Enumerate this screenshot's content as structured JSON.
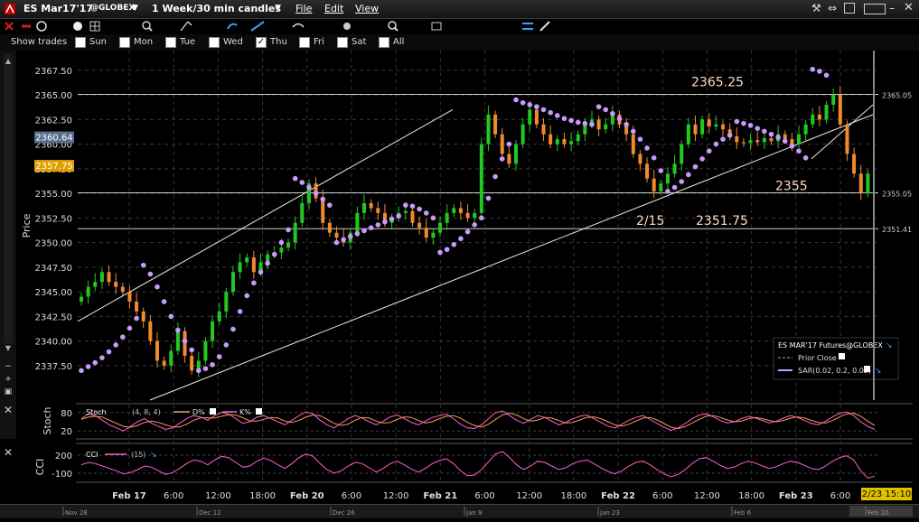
{
  "window": {
    "symbol": "ES Mar17'17",
    "exchange": "@GLOBEX",
    "timeframe": "1 Week/30 min candles",
    "menus": [
      "File",
      "Edit",
      "View"
    ]
  },
  "options": {
    "show_trades_label": "Show trades",
    "days": [
      {
        "label": "Sun",
        "checked": false
      },
      {
        "label": "Mon",
        "checked": false
      },
      {
        "label": "Tue",
        "checked": false
      },
      {
        "label": "Wed",
        "checked": false
      },
      {
        "label": "Thu",
        "checked": true
      },
      {
        "label": "Fri",
        "checked": false
      },
      {
        "label": "Sat",
        "checked": false
      },
      {
        "label": "All",
        "checked": false
      }
    ]
  },
  "chart_data": {
    "type": "candlestick",
    "ylabel": "Price",
    "ylim": [
      2334.0,
      2369.5
    ],
    "yticks": [
      "2367.50",
      "2365.00",
      "2362.50",
      "2360.00",
      "2357.50",
      "2355.00",
      "2352.50",
      "2350.00",
      "2347.50",
      "2345.00",
      "2342.50",
      "2340.00",
      "2337.50"
    ],
    "x_labels": [
      "Feb 17",
      "6:00",
      "12:00",
      "18:00",
      "Feb 20",
      "6:00",
      "12:00",
      "Feb 21",
      "6:00",
      "12:00",
      "18:00",
      "Feb 22",
      "6:00",
      "12:00",
      "18:00",
      "Feb 23",
      "6:00"
    ],
    "price_badges": [
      {
        "label": "2360.64",
        "value": 2360.64,
        "color": "#5a6f8a"
      },
      {
        "label": "2357.75",
        "value": 2357.75,
        "color": "#e0a000"
      }
    ],
    "right_labels": [
      {
        "label": "2365.05",
        "value": 2365.05
      },
      {
        "label": "2355.05",
        "value": 2355.05
      },
      {
        "label": "2351.41",
        "value": 2351.41
      }
    ],
    "annotations": [
      {
        "text": "2365.25",
        "value": 2365.25
      },
      {
        "text": "2355",
        "value": 2355.05
      },
      {
        "text": "2/15",
        "value": 2351.41
      },
      {
        "text": "2351.75",
        "value": 2351.41
      }
    ],
    "horizontal_levels": [
      2365.05,
      2355.05,
      2351.41
    ],
    "channel_upper": [
      [
        0,
        2342
      ],
      [
        415,
        2363.5
      ]
    ],
    "channel_lower": [
      [
        80,
        2334
      ],
      [
        880,
        2363
      ]
    ],
    "channel_short": [
      [
        812,
        2358.5
      ],
      [
        880,
        2364
      ]
    ],
    "series": [
      {
        "name": "ES MAR'17 Futures@GLOBEX",
        "kind": "candles",
        "up_color": "#22c822",
        "down_color": "#f08a30",
        "close": [
          2344.5,
          2345.5,
          2346,
          2347,
          2346,
          2345.5,
          2345,
          2344,
          2343,
          2342,
          2340,
          2338,
          2337.5,
          2339,
          2341,
          2338.5,
          2337,
          2338,
          2340,
          2342,
          2343,
          2345,
          2347,
          2348,
          2348.5,
          2347,
          2348,
          2348.8,
          2349,
          2349.5,
          2350,
          2352,
          2354,
          2356,
          2354.5,
          2352,
          2351,
          2350.5,
          2350,
          2351,
          2353,
          2354,
          2353.5,
          2353,
          2352,
          2352.5,
          2353,
          2353.2,
          2352,
          2351.5,
          2350.5,
          2351,
          2352,
          2353,
          2353.5,
          2353,
          2352.5,
          2353,
          2360,
          2363,
          2361,
          2359,
          2358,
          2360,
          2362,
          2363.5,
          2362,
          2361,
          2360,
          2360.5,
          2360,
          2360.3,
          2361,
          2362,
          2362.5,
          2361.5,
          2362,
          2363,
          2362,
          2361,
          2359,
          2358,
          2356.5,
          2355.2,
          2356,
          2357,
          2358,
          2360,
          2362,
          2361,
          2362.5,
          2361.8,
          2362,
          2361.5,
          2360.8,
          2360.2,
          2360.1,
          2360.4,
          2360.2,
          2360.6,
          2360.3,
          2361,
          2360.5,
          2360,
          2361,
          2362,
          2363,
          2362.5,
          2364,
          2365,
          2362,
          2359,
          2357,
          2355,
          2357
        ]
      }
    ],
    "sar": [
      2337.0,
      2337.4,
      2337.8,
      2338.3,
      2338.9,
      2339.6,
      2340.4,
      2341.3,
      2342.3,
      2347.7,
      2346.8,
      2345.5,
      2344.0,
      2342.5,
      2341.1,
      2340.0,
      2339.1,
      2337.0,
      2337.2,
      2337.6,
      2338.4,
      2339.6,
      2341.2,
      2343.0,
      2344.6,
      2345.9,
      2347.0,
      2347.9,
      2348.8,
      2350.0,
      2351.3,
      2356.5,
      2356.1,
      2355.6,
      2355.0,
      2354.4,
      2353.8,
      2350.0,
      2350.3,
      2350.6,
      2350.9,
      2351.2,
      2351.5,
      2351.8,
      2352.1,
      2352.4,
      2352.7,
      2353.8,
      2353.7,
      2353.4,
      2353.0,
      2352.5,
      2349.0,
      2349.3,
      2349.8,
      2350.4,
      2351.1,
      2351.8,
      2352.5,
      2354.5,
      2356.7,
      2358.5,
      2360.0,
      2364.5,
      2364.2,
      2364.0,
      2363.8,
      2363.5,
      2363.2,
      2362.9,
      2362.6,
      2362.4,
      2362.2,
      2362.1,
      2362.0,
      2363.8,
      2363.5,
      2363.1,
      2362.6,
      2362.0,
      2361.3,
      2360.5,
      2359.6,
      2358.6,
      2357.3,
      2355.2,
      2355.6,
      2356.2,
      2356.9,
      2357.7,
      2358.5,
      2359.3,
      2360.0,
      2360.5,
      2360.9,
      2362.3,
      2362.1,
      2361.9,
      2361.6,
      2361.3,
      2361.0,
      2360.7,
      2360.3,
      2359.8,
      2359.3,
      2358.6,
      2367.6,
      2367.4,
      2367.0
    ],
    "sar_color": "#c89aff",
    "legend": {
      "title": "ES MAR'17 Futures@GLOBEX",
      "items": [
        "Prior Close",
        "SAR(0.02, 0.2, 0.02)"
      ]
    },
    "stoch": {
      "label": "Stoch",
      "params": "(4, 8, 4)",
      "lines": [
        "D%",
        "K%"
      ],
      "yticks": [
        "80",
        "20"
      ],
      "ylim": [
        0,
        100
      ],
      "k": [
        60,
        75,
        70,
        55,
        40,
        30,
        20,
        35,
        50,
        60,
        45,
        35,
        25,
        30,
        45,
        60,
        70,
        65,
        55,
        70,
        80,
        75,
        60,
        45,
        50,
        65,
        70,
        60,
        50,
        40,
        55,
        70,
        82,
        76,
        55,
        40,
        30,
        45,
        60,
        70,
        62,
        50,
        40,
        52,
        66,
        72,
        60,
        48,
        40,
        52,
        64,
        70,
        75,
        60,
        42,
        30,
        28,
        40,
        60,
        80,
        85,
        70,
        55,
        45,
        58,
        70,
        64,
        52,
        40,
        48,
        60,
        68,
        72,
        60,
        48,
        36,
        30,
        42,
        55,
        64,
        70,
        58,
        44,
        32,
        22,
        30,
        44,
        60,
        72,
        76,
        66,
        54,
        46,
        50,
        60,
        68,
        62,
        54,
        46,
        52,
        62,
        70,
        64,
        54,
        44,
        40,
        52,
        66,
        78,
        82,
        70,
        50,
        35,
        25
      ],
      "d": [
        58,
        65,
        68,
        65,
        55,
        45,
        35,
        32,
        38,
        48,
        52,
        48,
        40,
        33,
        33,
        42,
        55,
        63,
        63,
        62,
        68,
        73,
        72,
        63,
        53,
        52,
        58,
        64,
        62,
        52,
        48,
        55,
        65,
        72,
        70,
        58,
        45,
        38,
        42,
        55,
        64,
        62,
        52,
        46,
        48,
        58,
        66,
        64,
        54,
        46,
        50,
        60,
        68,
        70,
        62,
        48,
        38,
        33,
        42,
        58,
        72,
        78,
        72,
        60,
        52,
        55,
        64,
        62,
        54,
        46,
        48,
        56,
        64,
        66,
        60,
        50,
        40,
        36,
        42,
        52,
        62,
        64,
        56,
        44,
        32,
        28,
        34,
        46,
        58,
        68,
        70,
        64,
        56,
        50,
        52,
        60,
        64,
        60,
        54,
        50,
        54,
        62,
        66,
        62,
        54,
        48,
        46,
        54,
        66,
        76,
        78,
        68,
        52,
        38
      ]
    },
    "cci": {
      "label": "CCI",
      "params": "(15)",
      "yticks": [
        "200",
        "-100"
      ],
      "ylim": [
        -220,
        320
      ],
      "values": [
        40,
        80,
        60,
        20,
        -20,
        -60,
        -110,
        -90,
        -40,
        20,
        0,
        -60,
        -120,
        -90,
        -20,
        60,
        120,
        100,
        40,
        120,
        180,
        160,
        80,
        0,
        20,
        100,
        150,
        110,
        40,
        -20,
        60,
        160,
        220,
        180,
        60,
        -40,
        -100,
        -60,
        20,
        80,
        60,
        -10,
        -80,
        -20,
        60,
        100,
        40,
        -30,
        -80,
        -20,
        60,
        110,
        140,
        60,
        -60,
        -140,
        -130,
        -40,
        90,
        220,
        260,
        160,
        40,
        -40,
        20,
        100,
        80,
        20,
        -40,
        -10,
        60,
        100,
        120,
        60,
        -10,
        -70,
        -110,
        -60,
        20,
        80,
        100,
        40,
        -40,
        -110,
        -160,
        -120,
        -40,
        60,
        140,
        160,
        100,
        30,
        -20,
        0,
        60,
        100,
        70,
        20,
        -20,
        10,
        60,
        100,
        80,
        30,
        -20,
        -40,
        20,
        100,
        160,
        190,
        120,
        -60,
        -180,
        -150
      ]
    },
    "x_axis_badge": "2/23 15:10",
    "bottom_dates": [
      "Nov 28",
      "Dec 12",
      "Dec 26",
      "Jan 9",
      "Jan 23",
      "Feb 6",
      "Feb 20"
    ]
  }
}
